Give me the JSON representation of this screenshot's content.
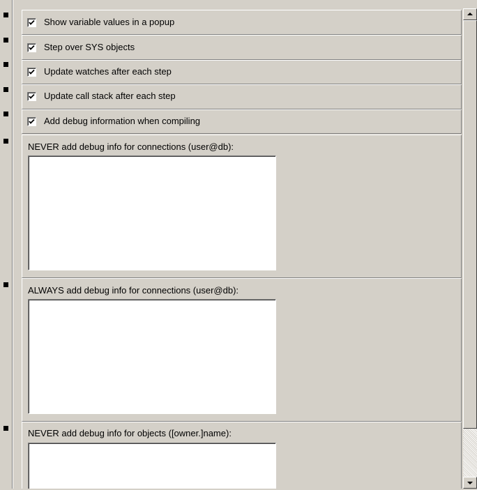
{
  "options": {
    "checkboxes": [
      {
        "label": "Show variable values in a popup",
        "checked": true
      },
      {
        "label": "Step over SYS objects",
        "checked": true
      },
      {
        "label": "Update watches after each step",
        "checked": true
      },
      {
        "label": "Update call stack after each step",
        "checked": true
      },
      {
        "label": "Add debug information when compiling",
        "checked": true
      }
    ],
    "lists": [
      {
        "label": "NEVER add debug info for connections (user@db):",
        "value": ""
      },
      {
        "label": "ALWAYS add debug info for connections (user@db):",
        "value": ""
      },
      {
        "label": "NEVER add debug info for objects ([owner.]name):",
        "value": ""
      }
    ]
  },
  "colors": {
    "background": "#d4d0c8",
    "field": "#ffffff",
    "bullet": "#000000"
  },
  "icons": [
    "checkmark-icon",
    "scroll-up-arrow-icon",
    "scroll-down-arrow-icon"
  ]
}
